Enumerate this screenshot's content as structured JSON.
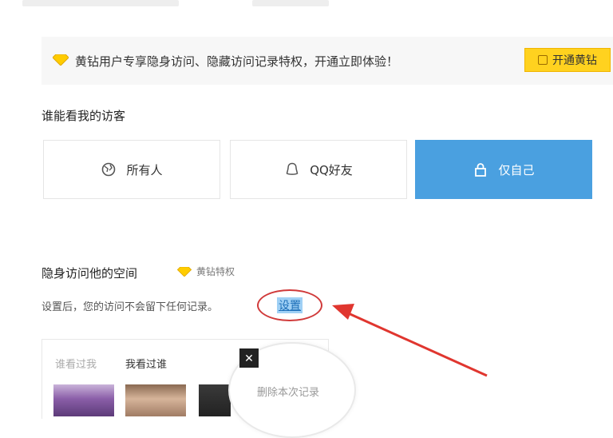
{
  "banner": {
    "text": "黄钻用户专享隐身访问、隐藏访问记录特权，开通立即体验！",
    "button_label": "开通黄钻",
    "accent_color": "#ffd21f"
  },
  "visibility": {
    "title": "谁能看我的访客",
    "options": [
      {
        "label": "所有人",
        "icon": "globe-icon",
        "selected": false
      },
      {
        "label": "QQ好友",
        "icon": "person-icon",
        "selected": false
      },
      {
        "label": "仅自己",
        "icon": "lock-icon",
        "selected": true
      }
    ],
    "selected_color": "#4aa0e0"
  },
  "invisible": {
    "title": "隐身访问他的空间",
    "vip_tag": "黄钻特权",
    "description": "设置后，您的访问不会留下任何记录。",
    "set_link": "设置"
  },
  "history": {
    "tabs": [
      "谁看过我",
      "我看过谁"
    ],
    "active_tab": "我看过谁",
    "delete_label": "删除本次记录"
  }
}
